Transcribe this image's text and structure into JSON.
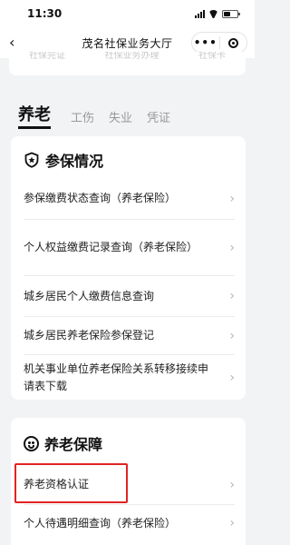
{
  "status": {
    "time": "11:30"
  },
  "nav": {
    "title": "茂名社保业务大厅"
  },
  "top_card": {
    "cut_texts": [
      "社保完证",
      "社保业务办理",
      "社保卡"
    ]
  },
  "tabs": [
    "养老",
    "工伤",
    "失业",
    "凭证"
  ],
  "sections": [
    {
      "title": "参保情况",
      "icon": "shield-icon",
      "items": [
        "参保缴费状态查询（养老保险）",
        "个人权益缴费记录查询（养老保险）",
        "城乡居民个人缴费信息查询",
        "城乡居民养老保险参保登记",
        "机关事业单位养老保险关系转移接续申请表下载"
      ]
    },
    {
      "title": "养老保障",
      "icon": "sad-face-icon",
      "items": [
        "养老资格认证",
        "个人待遇明细查询（养老保险）"
      ]
    }
  ],
  "highlight_color": "#e02424"
}
